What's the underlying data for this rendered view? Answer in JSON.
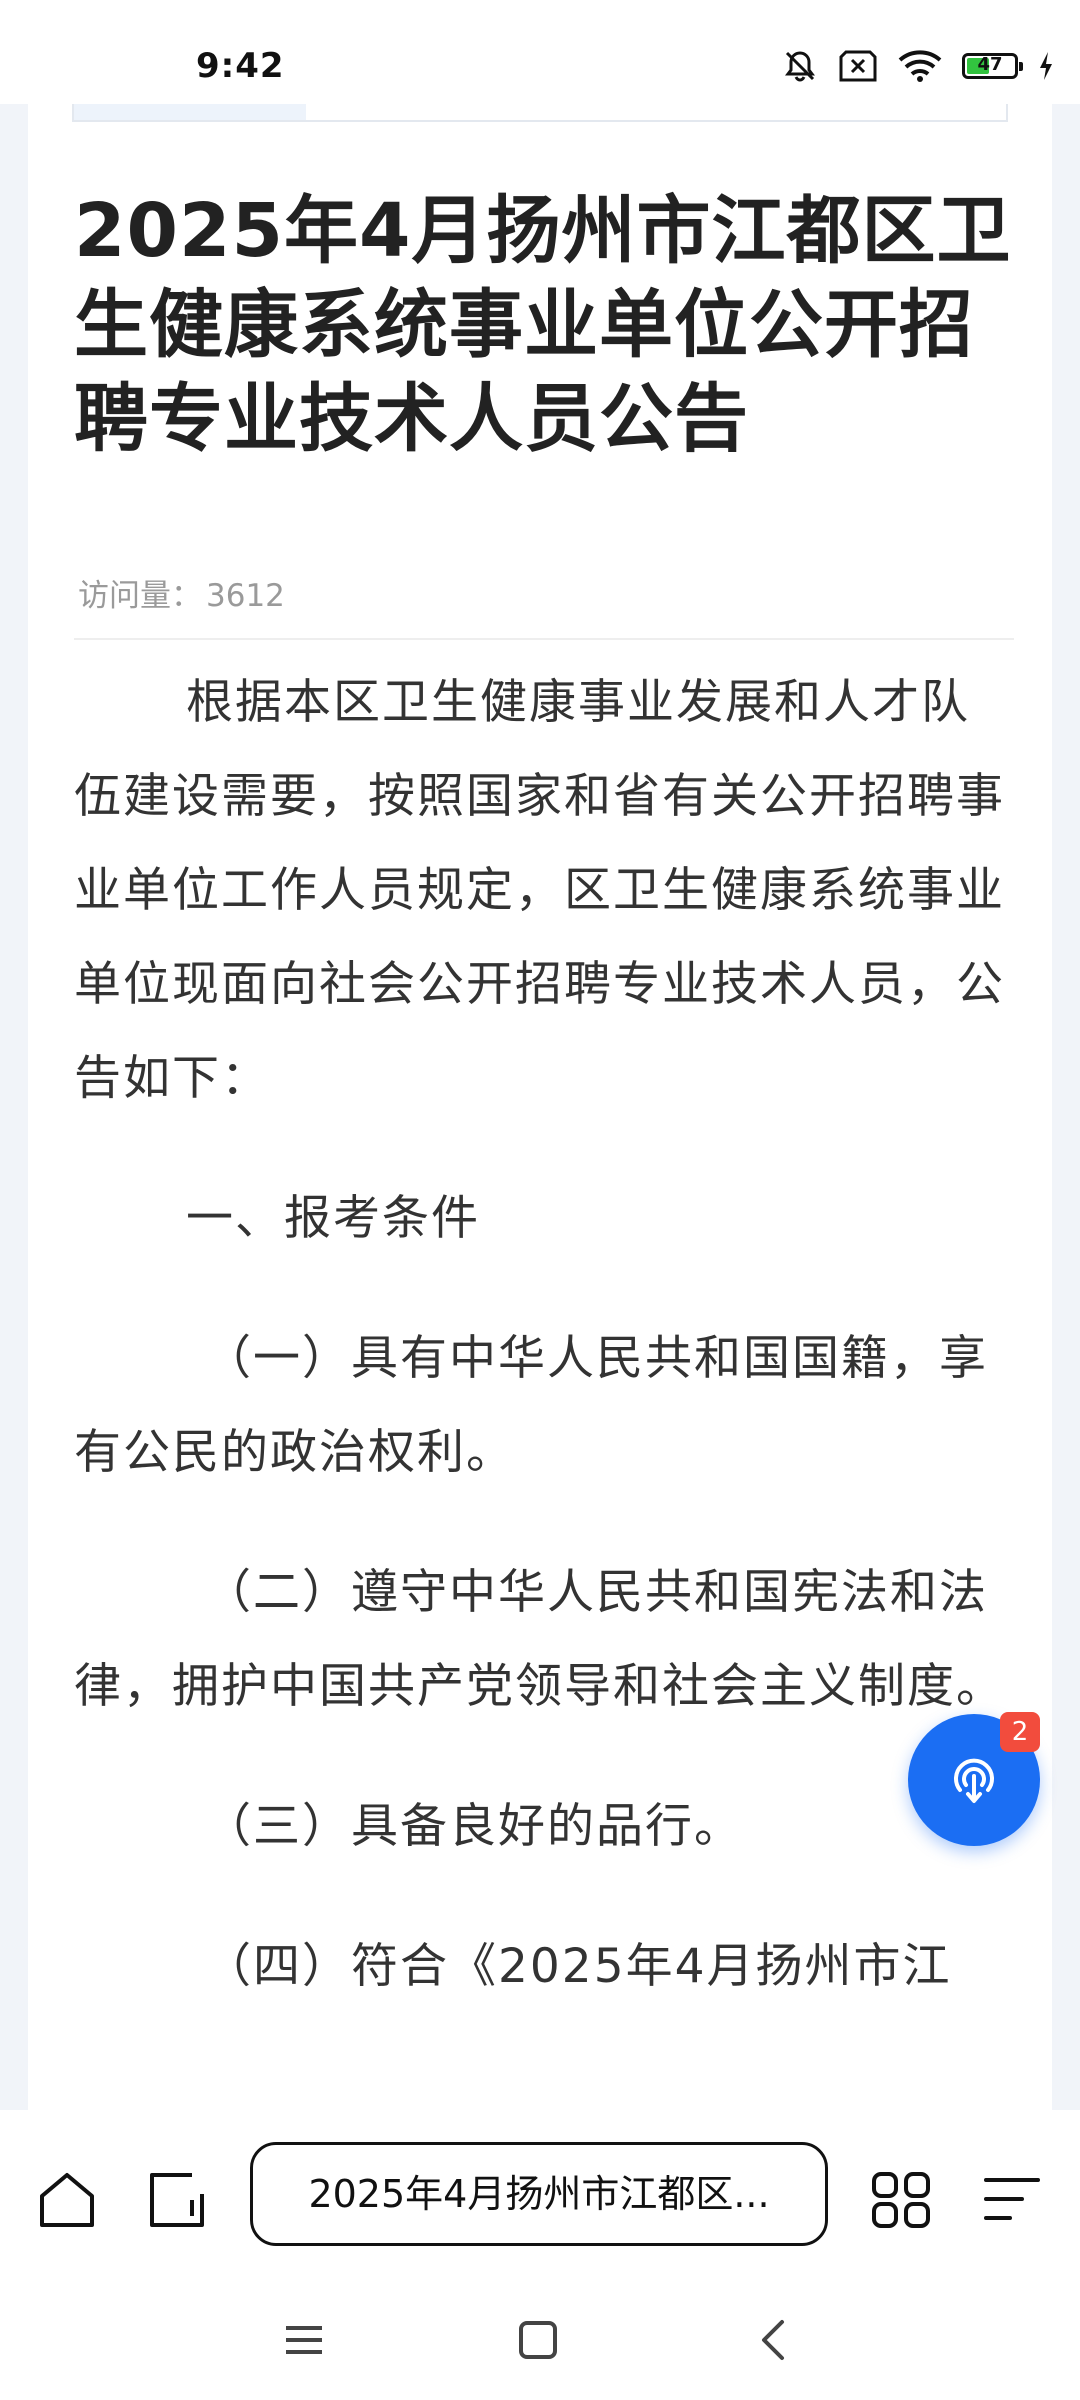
{
  "status_bar": {
    "time": "9:42",
    "battery_level": "47",
    "icons": [
      "bell-off-icon",
      "sim-x-icon",
      "wifi-icon",
      "battery-icon",
      "charging-icon"
    ]
  },
  "article": {
    "title": "2025年4月扬州市江都区卫生健康系统事业单位公开招聘专业技术人员公告",
    "visits_label": "访问量：",
    "visits_count": "3612",
    "paragraphs": [
      "根据本区卫生健康事业发展和人才队伍建设需要，按照国家和省有关公开招聘事业单位工作人员规定，区卫生健康系统事业单位现面向社会公开招聘专业技术人员，公告如下：",
      "一、报考条件",
      "（一）具有中华人民共和国国籍，享有公民的政治权利。",
      "（二）遵守中华人民共和国宪法和法律，拥护中国共产党领导和社会主义制度。",
      "（三）具备良好的品行。",
      "（四）符合《2025年4月扬州市江"
    ]
  },
  "fab": {
    "badge": "2",
    "icon": "podcast-icon"
  },
  "toolbar": {
    "url_title": "2025年4月扬州市江都区...",
    "icons": [
      "home-icon",
      "tabs-icon",
      "apps-grid-icon",
      "menu-icon"
    ]
  },
  "navbar": {
    "icons": [
      "recent-apps-icon",
      "home-square-icon",
      "back-icon"
    ]
  },
  "colors": {
    "accent": "#1b6ef3",
    "badge": "#f24c3d",
    "battery": "#32c33f"
  }
}
